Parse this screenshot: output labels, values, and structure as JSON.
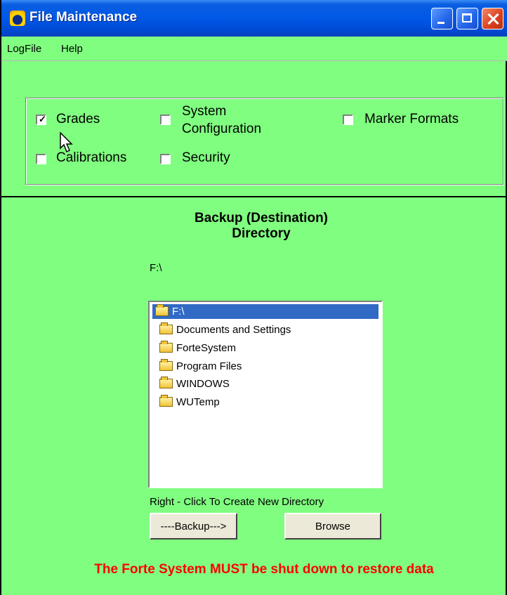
{
  "window": {
    "title": "File Maintenance",
    "icon": "app-icon"
  },
  "menu": [
    "LogFile",
    "Help"
  ],
  "checkboxes": [
    {
      "label": "Grades",
      "checked": true
    },
    {
      "label": "System Configuration",
      "line1": "System",
      "line2": "Configuration",
      "checked": false
    },
    {
      "label": "Marker Formats",
      "checked": false
    },
    {
      "label": "Calibrations",
      "checked": false
    },
    {
      "label": "Security",
      "checked": false
    }
  ],
  "heading": {
    "line1": "Backup (Destination)",
    "line2": "Directory"
  },
  "current_path": "F:\\",
  "directories": [
    {
      "name": "F:\\",
      "selected": true,
      "icon": "open-folder-icon"
    },
    {
      "name": "Documents and Settings",
      "selected": false,
      "icon": "folder-icon"
    },
    {
      "name": "ForteSystem",
      "selected": false,
      "icon": "folder-icon"
    },
    {
      "name": "Program Files",
      "selected": false,
      "icon": "folder-icon"
    },
    {
      "name": "WINDOWS",
      "selected": false,
      "icon": "folder-icon"
    },
    {
      "name": "WUTemp",
      "selected": false,
      "icon": "folder-icon"
    }
  ],
  "hint": "Right - Click To Create New Directory",
  "buttons": {
    "backup": "----Backup--->",
    "browse": "Browse"
  },
  "warning": "The Forte System MUST be shut down to restore data",
  "colors": {
    "background": "#80fe80",
    "selection": "#316ac5",
    "warning": "#ff0000"
  }
}
